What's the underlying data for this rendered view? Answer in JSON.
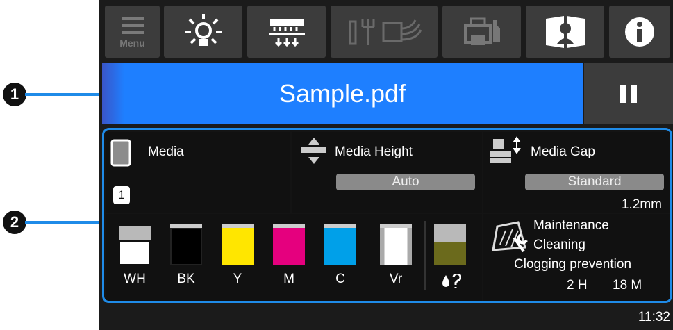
{
  "callouts": {
    "one": "1",
    "two": "2"
  },
  "toolbar": {
    "menu_label": "Menu",
    "icons": [
      "menu-icon",
      "lamp-icon",
      "heater-icon",
      "ink-fork-icon",
      "network-icon",
      "printer-settings-icon",
      "user-guide-icon",
      "info-icon"
    ]
  },
  "job": {
    "title": "Sample.pdf"
  },
  "status": {
    "media": {
      "label": "Media",
      "slot": "1"
    },
    "media_height": {
      "label": "Media Height",
      "value": "Auto"
    },
    "media_gap": {
      "label": "Media Gap",
      "value": "Standard",
      "detail": "1.2mm"
    },
    "inks": [
      {
        "label": "WH",
        "fill": "#ffffff",
        "level": 0.6
      },
      {
        "label": "BK",
        "fill": "#000000",
        "level": 1.0
      },
      {
        "label": "Y",
        "fill": "#ffe600",
        "level": 1.0
      },
      {
        "label": "M",
        "fill": "#e5007e",
        "level": 1.0
      },
      {
        "label": "C",
        "fill": "#00a0e9",
        "level": 1.0
      },
      {
        "label": "Vr",
        "fill": "#ffffff",
        "level": 1.0
      }
    ],
    "waste": {
      "fill": "#6b6a1c",
      "level": 0.55
    },
    "maintenance": {
      "line1": "Maintenance",
      "line2": "Cleaning",
      "line3": "Clogging prevention",
      "time_h": "2 H",
      "time_m": "18 M"
    }
  },
  "clock": "11:32",
  "colors": {
    "accent": "#1e7fff",
    "frame": "#1f8be8",
    "button": "#3c3c3c"
  }
}
